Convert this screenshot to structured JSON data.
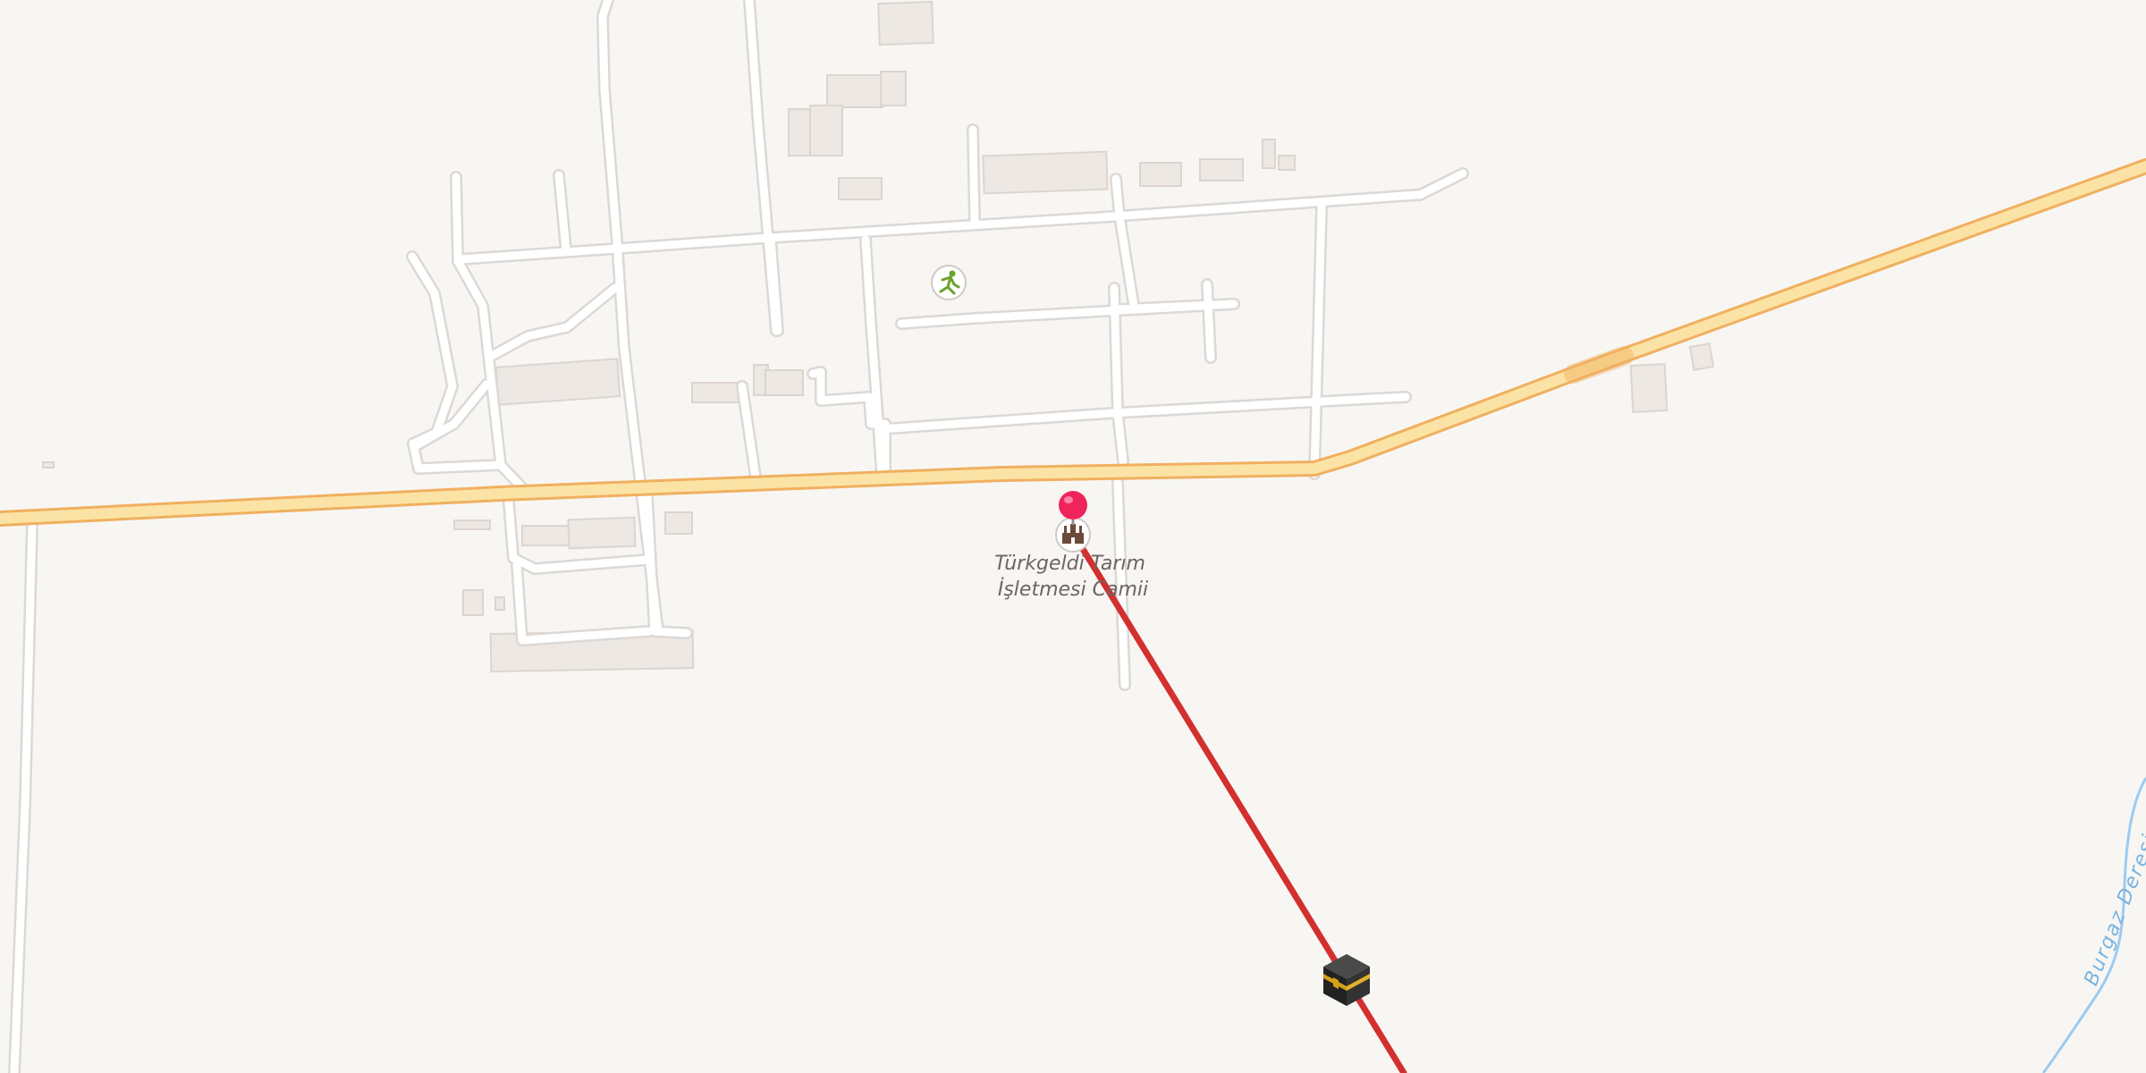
{
  "map": {
    "background_color": "#f8f6f3",
    "colors": {
      "road_main_fill": "#fbe3a5",
      "road_main_casing": "#f0b060",
      "road_minor_fill": "#ffffff",
      "road_minor_casing": "#dcd8d5",
      "building_fill": "#ede8e4",
      "building_shadow": "#d9d2cc",
      "waterway": "#9ccbf1",
      "qibla_line": "#d32f2f",
      "pin": "#f0245c"
    },
    "poi": {
      "name_line1": "Türkgeldi Tarım",
      "name_line2": "İşletmesi Camii",
      "icon": "mosque-icon"
    },
    "waterway": {
      "name": "Burgaz Deresi"
    },
    "icons": {
      "sports": "sports-running-icon",
      "kaaba": "kaaba-icon",
      "location_pin": "location-pin-icon"
    }
  }
}
